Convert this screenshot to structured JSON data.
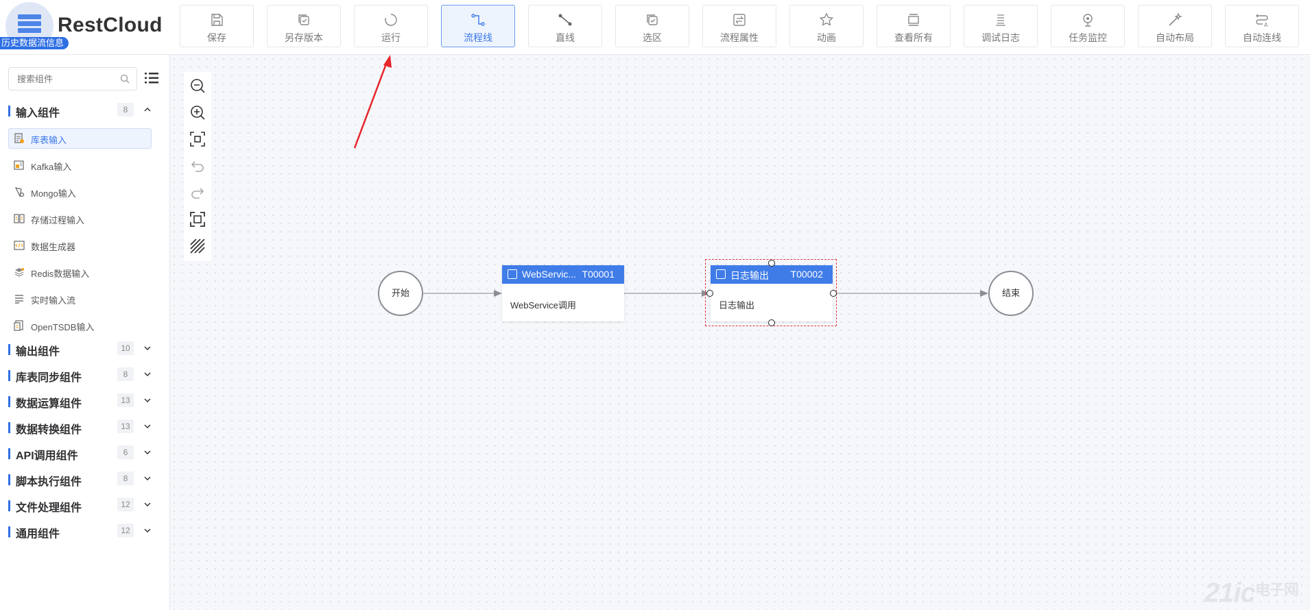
{
  "app": {
    "brand": "RestCloud",
    "history_badge": "历史数据流信息"
  },
  "toolbar": {
    "buttons": [
      {
        "label": "保存",
        "icon": "save-icon"
      },
      {
        "label": "另存版本",
        "icon": "save-version-icon"
      },
      {
        "label": "运行",
        "icon": "run-icon"
      },
      {
        "label": "流程线",
        "icon": "flow-line-icon",
        "active": true
      },
      {
        "label": "直线",
        "icon": "straight-line-icon"
      },
      {
        "label": "选区",
        "icon": "selection-icon"
      },
      {
        "label": "流程属性",
        "icon": "flow-properties-icon"
      },
      {
        "label": "动画",
        "icon": "animation-icon"
      },
      {
        "label": "查看所有",
        "icon": "view-all-icon"
      },
      {
        "label": "调试日志",
        "icon": "debug-log-icon"
      },
      {
        "label": "任务监控",
        "icon": "task-monitor-icon"
      },
      {
        "label": "自动布局",
        "icon": "auto-layout-icon"
      },
      {
        "label": "自动连线",
        "icon": "auto-connect-icon"
      }
    ]
  },
  "sidebar": {
    "search_placeholder": "搜索组件",
    "categories": [
      {
        "name": "输入组件",
        "count": "8",
        "expanded": true,
        "items": [
          {
            "name": "库表输入",
            "selected": true
          },
          {
            "name": "Kafka输入"
          },
          {
            "name": "Mongo输入"
          },
          {
            "name": "存储过程输入"
          },
          {
            "name": "数据生成器"
          },
          {
            "name": "Redis数据输入"
          },
          {
            "name": "实时输入流"
          },
          {
            "name": "OpenTSDB输入"
          }
        ]
      },
      {
        "name": "输出组件",
        "count": "10"
      },
      {
        "name": "库表同步组件",
        "count": "8"
      },
      {
        "name": "数据运算组件",
        "count": "13"
      },
      {
        "name": "数据转换组件",
        "count": "13"
      },
      {
        "name": "API调用组件",
        "count": "6"
      },
      {
        "name": "脚本执行组件",
        "count": "8"
      },
      {
        "name": "文件处理组件",
        "count": "12"
      },
      {
        "name": "通用组件",
        "count": "12"
      }
    ]
  },
  "canvas_tools": [
    "zoom-out-icon",
    "zoom-in-icon",
    "fit-center-icon",
    "undo-icon",
    "redo-icon",
    "fit-screen-icon",
    "grid-toggle-icon"
  ],
  "flow": {
    "start_label": "开始",
    "end_label": "结束",
    "tasks": [
      {
        "title": "WebServic...",
        "id": "T00001",
        "body": "WebService调用"
      },
      {
        "title": "日志输出",
        "id": "T00002",
        "body": "日志输出",
        "selected": true
      }
    ]
  },
  "watermark": {
    "text": "21ic",
    "sub": "电子网"
  },
  "colors": {
    "accent": "#3f7ce8",
    "selection": "#e8383d",
    "annotation_arrow": "#e8262c"
  }
}
